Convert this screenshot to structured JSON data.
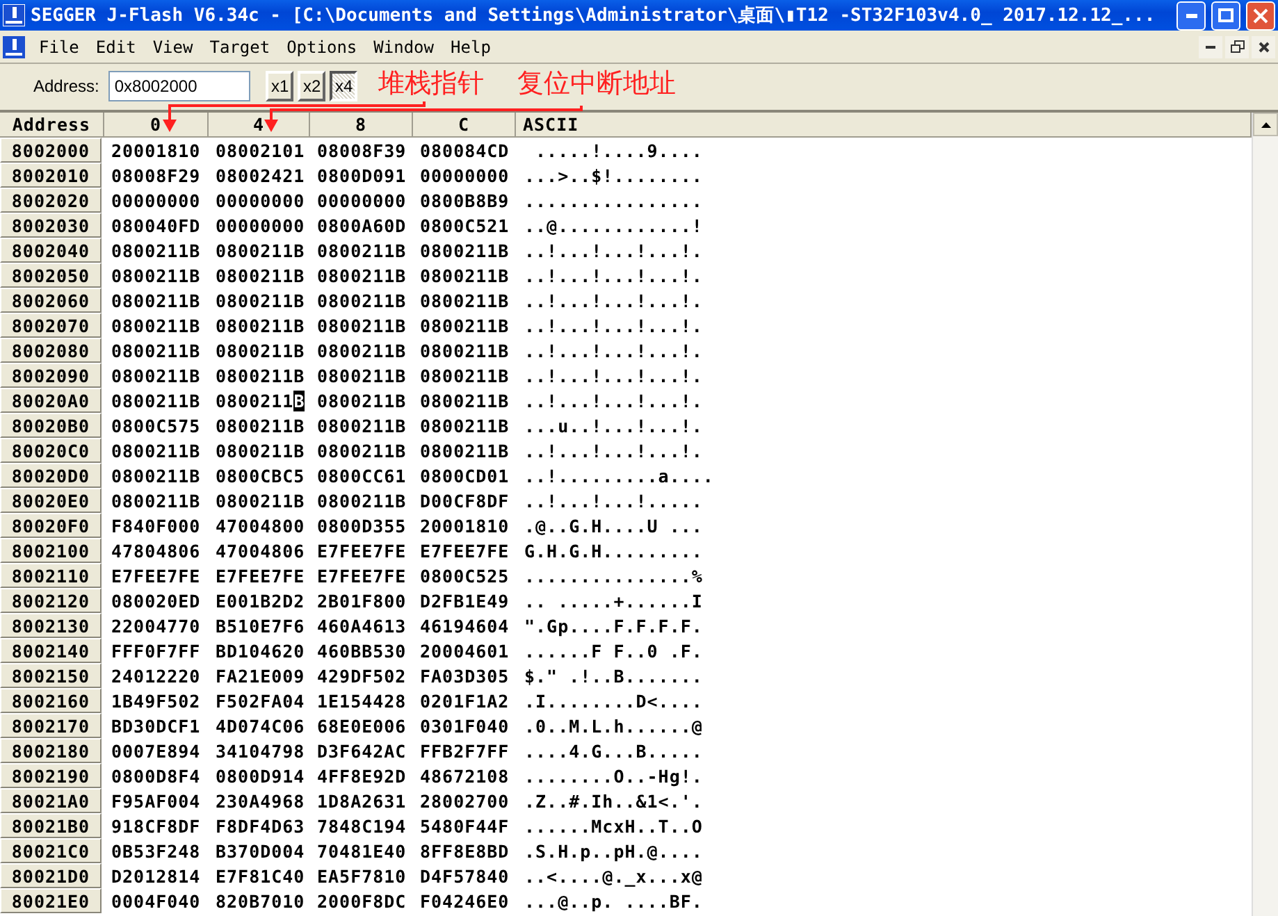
{
  "window": {
    "title": "SEGGER J-Flash V6.34c - [C:\\Documents and Settings\\Administrator\\桌面\\▮T12 -ST32F103v4.0_ 2017.12.12_..."
  },
  "menu": [
    "File",
    "Edit",
    "View",
    "Target",
    "Options",
    "Window",
    "Help"
  ],
  "toolbar": {
    "address_label": "Address:",
    "address_value": "0x8002000",
    "zoom_buttons": [
      {
        "label": "x1",
        "pressed": false
      },
      {
        "label": "x2",
        "pressed": false
      },
      {
        "label": "x4",
        "pressed": true
      }
    ]
  },
  "table": {
    "columns": [
      "Address",
      "0",
      "4",
      "8",
      "C",
      "ASCII"
    ],
    "rows": [
      {
        "cells": [
          "8002000",
          "20001810",
          "08002101",
          "08008F39",
          "080084CD",
          " .....!....9...."
        ],
        "cursor": false
      },
      {
        "cells": [
          "8002010",
          "08008F29",
          "08002421",
          "0800D091",
          "00000000",
          "...>..$!........"
        ],
        "cursor": false
      },
      {
        "cells": [
          "8002020",
          "00000000",
          "00000000",
          "00000000",
          "0800B8B9",
          "................"
        ],
        "cursor": false
      },
      {
        "cells": [
          "8002030",
          "080040FD",
          "00000000",
          "0800A60D",
          "0800C521",
          "..@............!"
        ],
        "cursor": false
      },
      {
        "cells": [
          "8002040",
          "0800211B",
          "0800211B",
          "0800211B",
          "0800211B",
          "..!...!...!...!."
        ],
        "cursor": false
      },
      {
        "cells": [
          "8002050",
          "0800211B",
          "0800211B",
          "0800211B",
          "0800211B",
          "..!...!...!...!."
        ],
        "cursor": false
      },
      {
        "cells": [
          "8002060",
          "0800211B",
          "0800211B",
          "0800211B",
          "0800211B",
          "..!...!...!...!."
        ],
        "cursor": false
      },
      {
        "cells": [
          "8002070",
          "0800211B",
          "0800211B",
          "0800211B",
          "0800211B",
          "..!...!...!...!."
        ],
        "cursor": false
      },
      {
        "cells": [
          "8002080",
          "0800211B",
          "0800211B",
          "0800211B",
          "0800211B",
          "..!...!...!...!."
        ],
        "cursor": false
      },
      {
        "cells": [
          "8002090",
          "0800211B",
          "0800211B",
          "0800211B",
          "0800211B",
          "..!...!...!...!."
        ],
        "cursor": false
      },
      {
        "cells": [
          "80020A0",
          "0800211B",
          "0800211B",
          "0800211B",
          "0800211B",
          "..!...!...!...!."
        ],
        "cursor": true
      },
      {
        "cells": [
          "80020B0",
          "0800C575",
          "0800211B",
          "0800211B",
          "0800211B",
          "...u..!...!...!."
        ],
        "cursor": false
      },
      {
        "cells": [
          "80020C0",
          "0800211B",
          "0800211B",
          "0800211B",
          "0800211B",
          "..!...!...!...!."
        ],
        "cursor": false
      },
      {
        "cells": [
          "80020D0",
          "0800211B",
          "0800CBC5",
          "0800CC61",
          "0800CD01",
          "..!.........a...."
        ],
        "cursor": false
      },
      {
        "cells": [
          "80020E0",
          "0800211B",
          "0800211B",
          "0800211B",
          "D00CF8DF",
          "..!...!...!....."
        ],
        "cursor": false
      },
      {
        "cells": [
          "80020F0",
          "F840F000",
          "47004800",
          "0800D355",
          "20001810",
          ".@..G.H....U ..."
        ],
        "cursor": false
      },
      {
        "cells": [
          "8002100",
          "47804806",
          "47004806",
          "E7FEE7FE",
          "E7FEE7FE",
          "G.H.G.H........."
        ],
        "cursor": false
      },
      {
        "cells": [
          "8002110",
          "E7FEE7FE",
          "E7FEE7FE",
          "E7FEE7FE",
          "0800C525",
          "...............%"
        ],
        "cursor": false
      },
      {
        "cells": [
          "8002120",
          "080020ED",
          "E001B2D2",
          "2B01F800",
          "D2FB1E49",
          ".. .....+......I"
        ],
        "cursor": false
      },
      {
        "cells": [
          "8002130",
          "22004770",
          "B510E7F6",
          "460A4613",
          "46194604",
          "\".Gp....F.F.F.F."
        ],
        "cursor": false
      },
      {
        "cells": [
          "8002140",
          "FFF0F7FF",
          "BD104620",
          "460BB530",
          "20004601",
          "......F F..0 .F."
        ],
        "cursor": false
      },
      {
        "cells": [
          "8002150",
          "24012220",
          "FA21E009",
          "429DF502",
          "FA03D305",
          "$.\" .!..B......."
        ],
        "cursor": false
      },
      {
        "cells": [
          "8002160",
          "1B49F502",
          "F502FA04",
          "1E154428",
          "0201F1A2",
          ".I........D<...."
        ],
        "cursor": false
      },
      {
        "cells": [
          "8002170",
          "BD30DCF1",
          "4D074C06",
          "68E0E006",
          "0301F040",
          ".0..M.L.h......@"
        ],
        "cursor": false
      },
      {
        "cells": [
          "8002180",
          "0007E894",
          "34104798",
          "D3F642AC",
          "FFB2F7FF",
          "....4.G...B....."
        ],
        "cursor": false
      },
      {
        "cells": [
          "8002190",
          "0800D8F4",
          "0800D914",
          "4FF8E92D",
          "48672108",
          "........O..-Hg!."
        ],
        "cursor": false
      },
      {
        "cells": [
          "80021A0",
          "F95AF004",
          "230A4968",
          "1D8A2631",
          "28002700",
          ".Z..#.Ih..&1<.'."
        ],
        "cursor": false
      },
      {
        "cells": [
          "80021B0",
          "918CF8DF",
          "F8DF4D63",
          "7848C194",
          "5480F44F",
          "......McxH..T..O"
        ],
        "cursor": false
      },
      {
        "cells": [
          "80021C0",
          "0B53F248",
          "B370D004",
          "70481E40",
          "8FF8E8BD",
          ".S.H.p..pH.@...."
        ],
        "cursor": false
      },
      {
        "cells": [
          "80021D0",
          "D2012814",
          "E7F81C40",
          "EA5F7810",
          "D4F57840",
          "..<....@._x...x@"
        ],
        "cursor": false
      },
      {
        "cells": [
          "80021E0",
          "0004F040",
          "820B7010",
          "2000F8DC",
          "F04246E0",
          "...@..p. ....BF."
        ],
        "cursor": false
      }
    ]
  },
  "annotations": [
    {
      "text": "堆栈指针"
    },
    {
      "text": "复位中断地址"
    }
  ]
}
